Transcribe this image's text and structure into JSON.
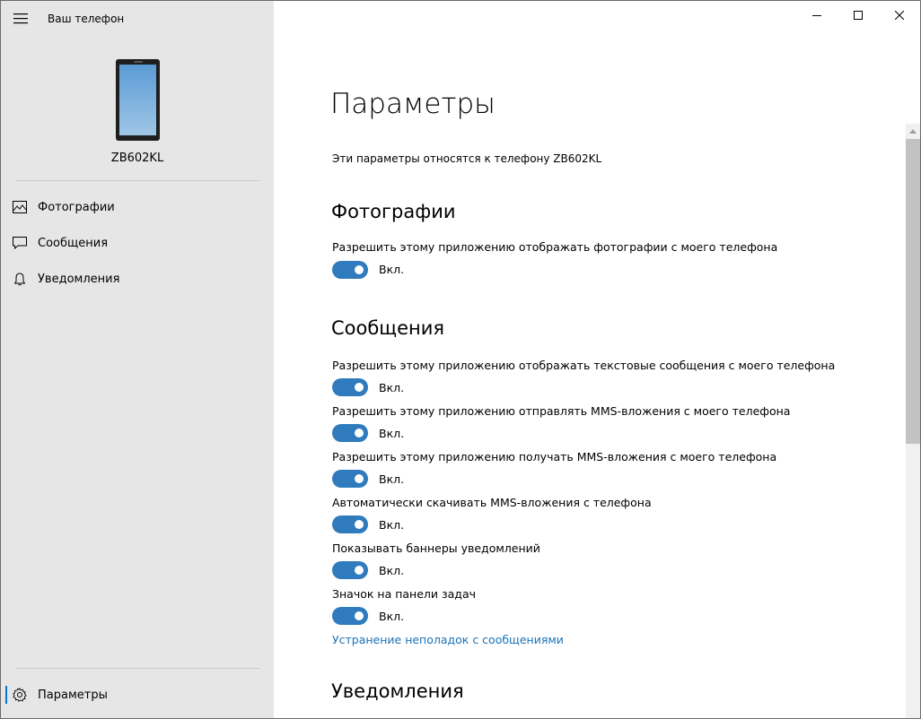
{
  "app": {
    "title": "Ваш телефон",
    "device_name": "ZB602KL"
  },
  "sidebar": {
    "items": [
      {
        "label": "Фотографии",
        "icon": "photo-icon"
      },
      {
        "label": "Сообщения",
        "icon": "message-icon"
      },
      {
        "label": "Уведомления",
        "icon": "bell-icon"
      }
    ],
    "settings_label": "Параметры"
  },
  "main": {
    "title": "Параметры",
    "subtitle": "Эти параметры относятся к телефону ZB602KL",
    "sections": [
      {
        "title": "Фотографии",
        "settings": [
          {
            "label": "Разрешить этому приложению отображать фотографии с моего телефона",
            "state": "Вкл.",
            "on": true
          }
        ]
      },
      {
        "title": "Сообщения",
        "settings": [
          {
            "label": "Разрешить этому приложению отображать текстовые сообщения с моего телефона",
            "state": "Вкл.",
            "on": true
          },
          {
            "label": "Разрешить этому приложению отправлять MMS-вложения с моего телефона",
            "state": "Вкл.",
            "on": true
          },
          {
            "label": "Разрешить этому приложению получать MMS-вложения с моего телефона",
            "state": "Вкл.",
            "on": true
          },
          {
            "label": "Автоматически скачивать MMS-вложения с телефона",
            "state": "Вкл.",
            "on": true
          },
          {
            "label": "Показывать баннеры уведомлений",
            "state": "Вкл.",
            "on": true
          },
          {
            "label": "Значок на панели задач",
            "state": "Вкл.",
            "on": true
          }
        ],
        "link": "Устранение неполадок с сообщениями"
      },
      {
        "title": "Уведомления"
      }
    ]
  },
  "colors": {
    "accent": "#2f7bbd",
    "link": "#1a73b8",
    "sidebar_bg": "#e6e6e6"
  }
}
